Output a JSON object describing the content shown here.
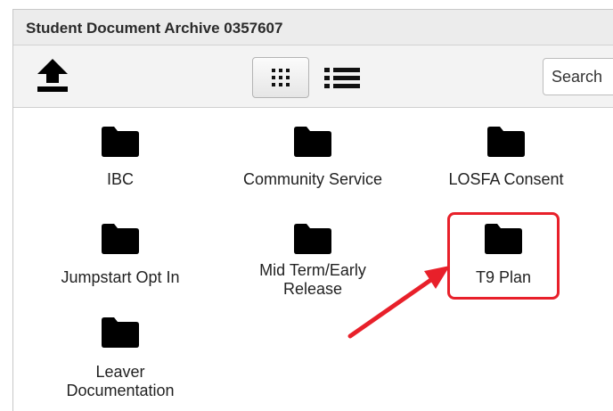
{
  "window": {
    "title": "Student Document Archive 0357607"
  },
  "toolbar": {
    "upload_icon": "upload-arrow-icon",
    "grid_view_icon": "grid-dots-icon",
    "list_view_icon": "list-icon",
    "search_placeholder": "Search"
  },
  "folders": [
    {
      "label": "IBC",
      "icon": "folder-icon"
    },
    {
      "label": "Community Service",
      "icon": "folder-icon"
    },
    {
      "label": "LOSFA Consent",
      "icon": "folder-icon"
    },
    {
      "label": "Jumpstart Opt In",
      "icon": "folder-icon"
    },
    {
      "label": "Mid Term/Early Release",
      "icon": "folder-icon"
    },
    {
      "label": "T9 Plan",
      "icon": "folder-icon"
    },
    {
      "label": "Leaver Documentation",
      "icon": "folder-icon"
    }
  ],
  "annotation": {
    "highlight_color": "#e8202a",
    "highlighted_folder": "T9 Plan"
  }
}
